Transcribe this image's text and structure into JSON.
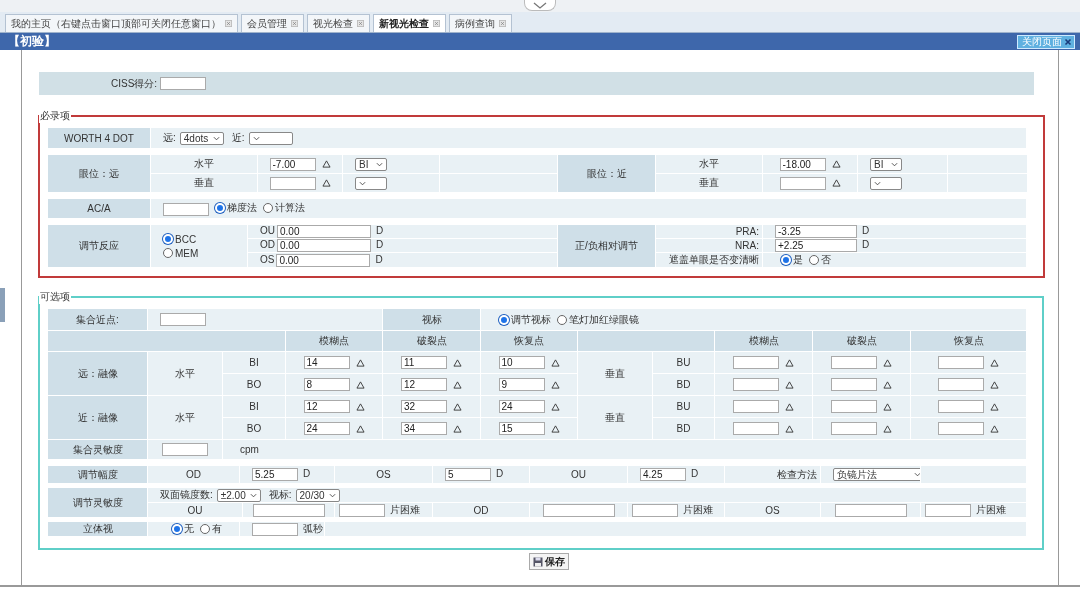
{
  "tabs": [
    {
      "label": "我的主页（右键点击窗口顶部可关闭任意窗口）",
      "selected": false
    },
    {
      "label": "会员管理",
      "selected": false
    },
    {
      "label": "视光检查",
      "selected": false
    },
    {
      "label": "新视光检查",
      "selected": true
    },
    {
      "label": "病例查询",
      "selected": false
    }
  ],
  "panel": {
    "title": "【初验】",
    "close_button": "关闭页面"
  },
  "ciss": {
    "label": "CISS得分:"
  },
  "required": {
    "legend": "必录项",
    "worth": {
      "label": "WORTH  4 DOT",
      "far_label": "远:",
      "far_value": "4dots",
      "near_label": "近:"
    },
    "positions": [
      {
        "label": "眼位：远",
        "rows": [
          {
            "label": "水平",
            "value": "-7.00",
            "base": "BI"
          },
          {
            "label": "垂直"
          }
        ]
      },
      {
        "label": "眼位：近",
        "rows": [
          {
            "label": "水平",
            "value": "-18.00",
            "base": "BI"
          },
          {
            "label": "垂直"
          }
        ]
      }
    ],
    "aca": {
      "label": "AC/A",
      "options": [
        {
          "label": "梯度法",
          "selected": true
        },
        {
          "label": "计算法",
          "selected": false
        }
      ]
    },
    "accommodation": {
      "label": "调节反应",
      "options": [
        {
          "label": "BCC",
          "selected": true
        },
        {
          "label": "MEM",
          "selected": false
        }
      ],
      "rows": [
        {
          "eye": "OU",
          "value": "0.00",
          "unit": "D"
        },
        {
          "eye": "OD",
          "value": "0.00",
          "unit": "D"
        },
        {
          "eye": "OS",
          "value": "0.00",
          "unit": "D"
        }
      ]
    },
    "relative": {
      "label": "正/负相对调节",
      "rows": [
        {
          "label": "PRA:",
          "value": "-3.25",
          "unit": "D"
        },
        {
          "label": "NRA:",
          "value": "+2.25",
          "unit": "D"
        }
      ],
      "cover": {
        "label": "遮盖单眼是否变清晰",
        "options": [
          {
            "label": "是",
            "selected": true
          },
          {
            "label": "否",
            "selected": false
          }
        ]
      }
    }
  },
  "optional": {
    "legend": "可选项",
    "npc": {
      "label": "集合近点:"
    },
    "target": {
      "label": "视标",
      "options": [
        {
          "label": "调节视标",
          "selected": true
        },
        {
          "label": "笔灯加红绿眼镜",
          "selected": false
        }
      ]
    },
    "left_headers": [
      "模糊点",
      "破裂点",
      "恢复点"
    ],
    "right_headers": [
      "模糊点",
      "破裂点",
      "恢复点"
    ],
    "fusion": [
      {
        "label": "远：融像",
        "horizontal": {
          "label": "水平",
          "rows": [
            {
              "base": "BI",
              "values": [
                "14",
                "11",
                "10"
              ]
            },
            {
              "base": "BO",
              "values": [
                "8",
                "12",
                "9"
              ]
            }
          ]
        },
        "vertical": {
          "label": "垂直",
          "rows": [
            {
              "base": "BU"
            },
            {
              "base": "BD"
            }
          ]
        }
      },
      {
        "label": "近：融像",
        "horizontal": {
          "label": "水平",
          "rows": [
            {
              "base": "BI",
              "values": [
                "12",
                "32",
                "24"
              ]
            },
            {
              "base": "BO",
              "values": [
                "24",
                "34",
                "15"
              ]
            }
          ]
        },
        "vertical": {
          "label": "垂直",
          "rows": [
            {
              "base": "BU"
            },
            {
              "base": "BD"
            }
          ]
        }
      }
    ],
    "vergence_facility": {
      "label": "集合灵敏度",
      "unit": "cpm"
    },
    "amplitude": {
      "label": "调节幅度",
      "eyes": [
        {
          "eye": "OD",
          "value": "5.25",
          "unit": "D"
        },
        {
          "eye": "OS",
          "value": "5",
          "unit": "D"
        },
        {
          "eye": "OU",
          "value": "4.25",
          "unit": "D"
        }
      ],
      "method_label": "检查方法",
      "method": "负镜片法"
    },
    "facility": {
      "label": "调节灵敏度",
      "flipper_label": "双面镜度数:",
      "flipper": "±2.00",
      "target_label": "视标:",
      "target": "20/30",
      "eyes": [
        {
          "eye": "OU",
          "difficulty": "片困难"
        },
        {
          "eye": "OD",
          "difficulty": "片困难"
        },
        {
          "eye": "OS",
          "difficulty": "片困难"
        }
      ]
    },
    "stereo": {
      "label": "立体视",
      "options": [
        {
          "label": "无",
          "selected": true
        },
        {
          "label": "有",
          "selected": false
        }
      ],
      "unit": "弧秒"
    }
  },
  "save_button": "保存"
}
